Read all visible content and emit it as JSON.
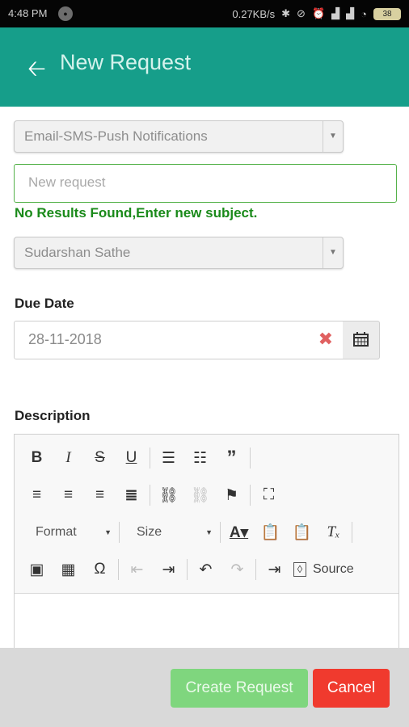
{
  "status_bar": {
    "time": "4:48 PM",
    "network_speed": "0.27KB/s",
    "battery": "38"
  },
  "header": {
    "title": "New Request",
    "back_icon": "arrow-left-icon"
  },
  "form": {
    "category_select": {
      "value": "Email-SMS-Push Notifications"
    },
    "subject_input": {
      "placeholder": "New request",
      "value": ""
    },
    "no_results_text": "No Results Found,Enter new subject.",
    "assignee_select": {
      "value": "Sudarshan Sathe"
    },
    "due_date_label": "Due Date",
    "due_date_value": "28-11-2018",
    "description_label": "Description"
  },
  "editor_toolbar": {
    "format_label": "Format",
    "size_label": "Size",
    "source_label": "Source",
    "icons": [
      "bold-icon",
      "italic-icon",
      "strikethrough-icon",
      "underline-icon",
      "bulleted-list-icon",
      "numbered-list-icon",
      "blockquote-icon",
      "align-left-icon",
      "align-center-icon",
      "align-right-icon",
      "justify-icon",
      "link-icon",
      "unlink-icon",
      "anchor-flag-icon",
      "maximize-icon",
      "text-color-icon",
      "paste-text-icon",
      "paste-word-icon",
      "remove-format-icon",
      "image-icon",
      "table-icon",
      "special-char-icon",
      "outdent-icon",
      "indent-icon",
      "undo-icon",
      "redo-icon",
      "insert-break-icon",
      "source-icon"
    ]
  },
  "actions": {
    "create_label": "Create Request",
    "cancel_label": "Cancel"
  },
  "colors": {
    "app_bar": "#169e8a",
    "success_text": "#1a8a1a",
    "create_button": "#7fd67e",
    "cancel_button": "#f03a2e"
  }
}
